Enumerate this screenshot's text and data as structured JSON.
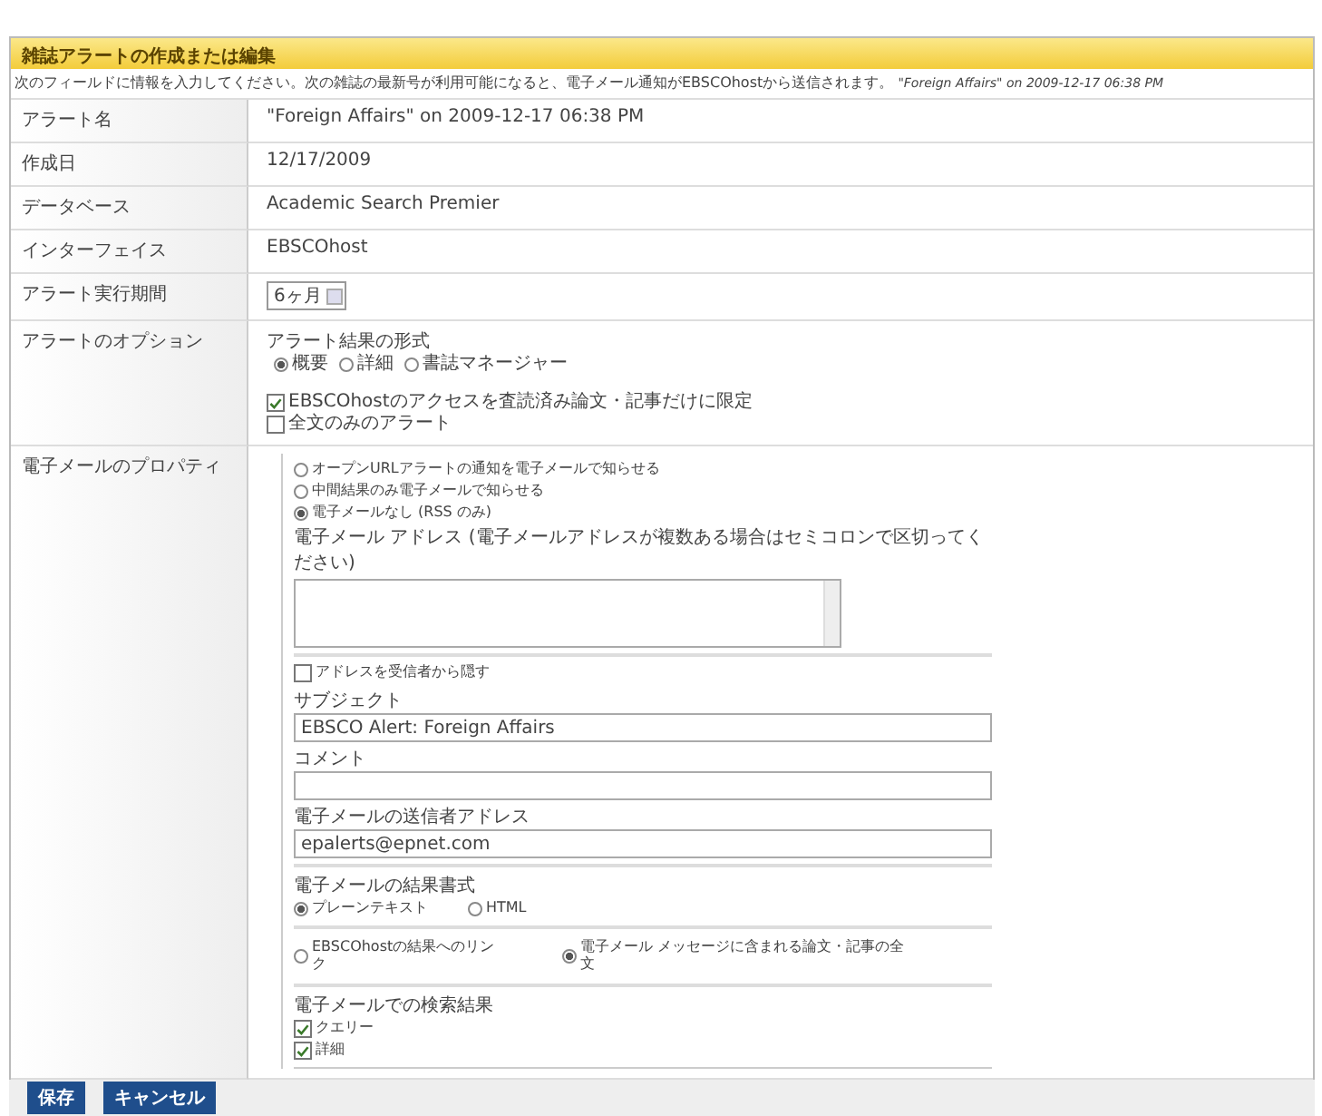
{
  "header": {
    "title": "雑誌アラートの作成または編集"
  },
  "intro": {
    "text": "次のフィールドに情報を入力してください。次の雑誌の最新号が利用可能になると、電子メール通知がEBSCOhostから送信されます。",
    "alert": "\"Foreign Affairs\" on 2009-12-17 06:38 PM"
  },
  "info_rows": [
    {
      "label": "アラート名",
      "value": "\"Foreign Affairs\" on 2009-12-17 06:38 PM"
    },
    {
      "label": "作成日",
      "value": "12/17/2009"
    },
    {
      "label": "データベース",
      "value": "Academic Search Premier"
    },
    {
      "label": "インターフェイス",
      "value": "EBSCOhost"
    }
  ],
  "period": {
    "label": "アラート実行期間",
    "value": "6ヶ月"
  },
  "options": {
    "label": "アラートのオプション",
    "format_label": "アラート結果の形式",
    "formats": [
      {
        "label": "概要",
        "selected": true
      },
      {
        "label": "詳細",
        "selected": false
      },
      {
        "label": "書誌マネージャー",
        "selected": false
      }
    ],
    "checks": [
      {
        "label": "EBSCOhostのアクセスを査読済み論文・記事だけに限定",
        "checked": true
      },
      {
        "label": "全文のみのアラート",
        "checked": false
      }
    ]
  },
  "email": {
    "label": "電子メールのプロパティ",
    "delivery": [
      {
        "label": "オープンURLアラートの通知を電子メールで知らせる",
        "selected": false
      },
      {
        "label": "中間結果のみ電子メールで知らせる",
        "selected": false
      },
      {
        "label": "電子メールなし (RSS のみ)",
        "selected": true
      }
    ],
    "address_label": "電子メール アドレス (電子メールアドレスが複数ある場合はセミコロンで区切ってください)",
    "hide_check": {
      "label": "アドレスを受信者から隠す",
      "checked": false
    },
    "fields": [
      {
        "label": "サブジェクト",
        "value": "EBSCO Alert: Foreign Affairs"
      },
      {
        "label": "コメント"
      },
      {
        "label": "電子メールの送信者アドレス",
        "value": "epalerts@epnet.com"
      }
    ],
    "format_label": "電子メールの結果書式",
    "formats": [
      {
        "label": "プレーンテキスト",
        "selected": true
      },
      {
        "label": "HTML",
        "selected": false
      }
    ],
    "link_options": [
      {
        "label": "EBSCOhostの結果へのリンク",
        "selected": false
      },
      {
        "label": "電子メール メッセージに含まれる論文・記事の全文",
        "selected": true
      }
    ],
    "results_label": "電子メールでの検索結果",
    "results": [
      {
        "label": "クエリー",
        "checked": true
      },
      {
        "label": "詳細",
        "checked": true
      }
    ]
  },
  "buttons": [
    "保存",
    "キャンセル"
  ]
}
